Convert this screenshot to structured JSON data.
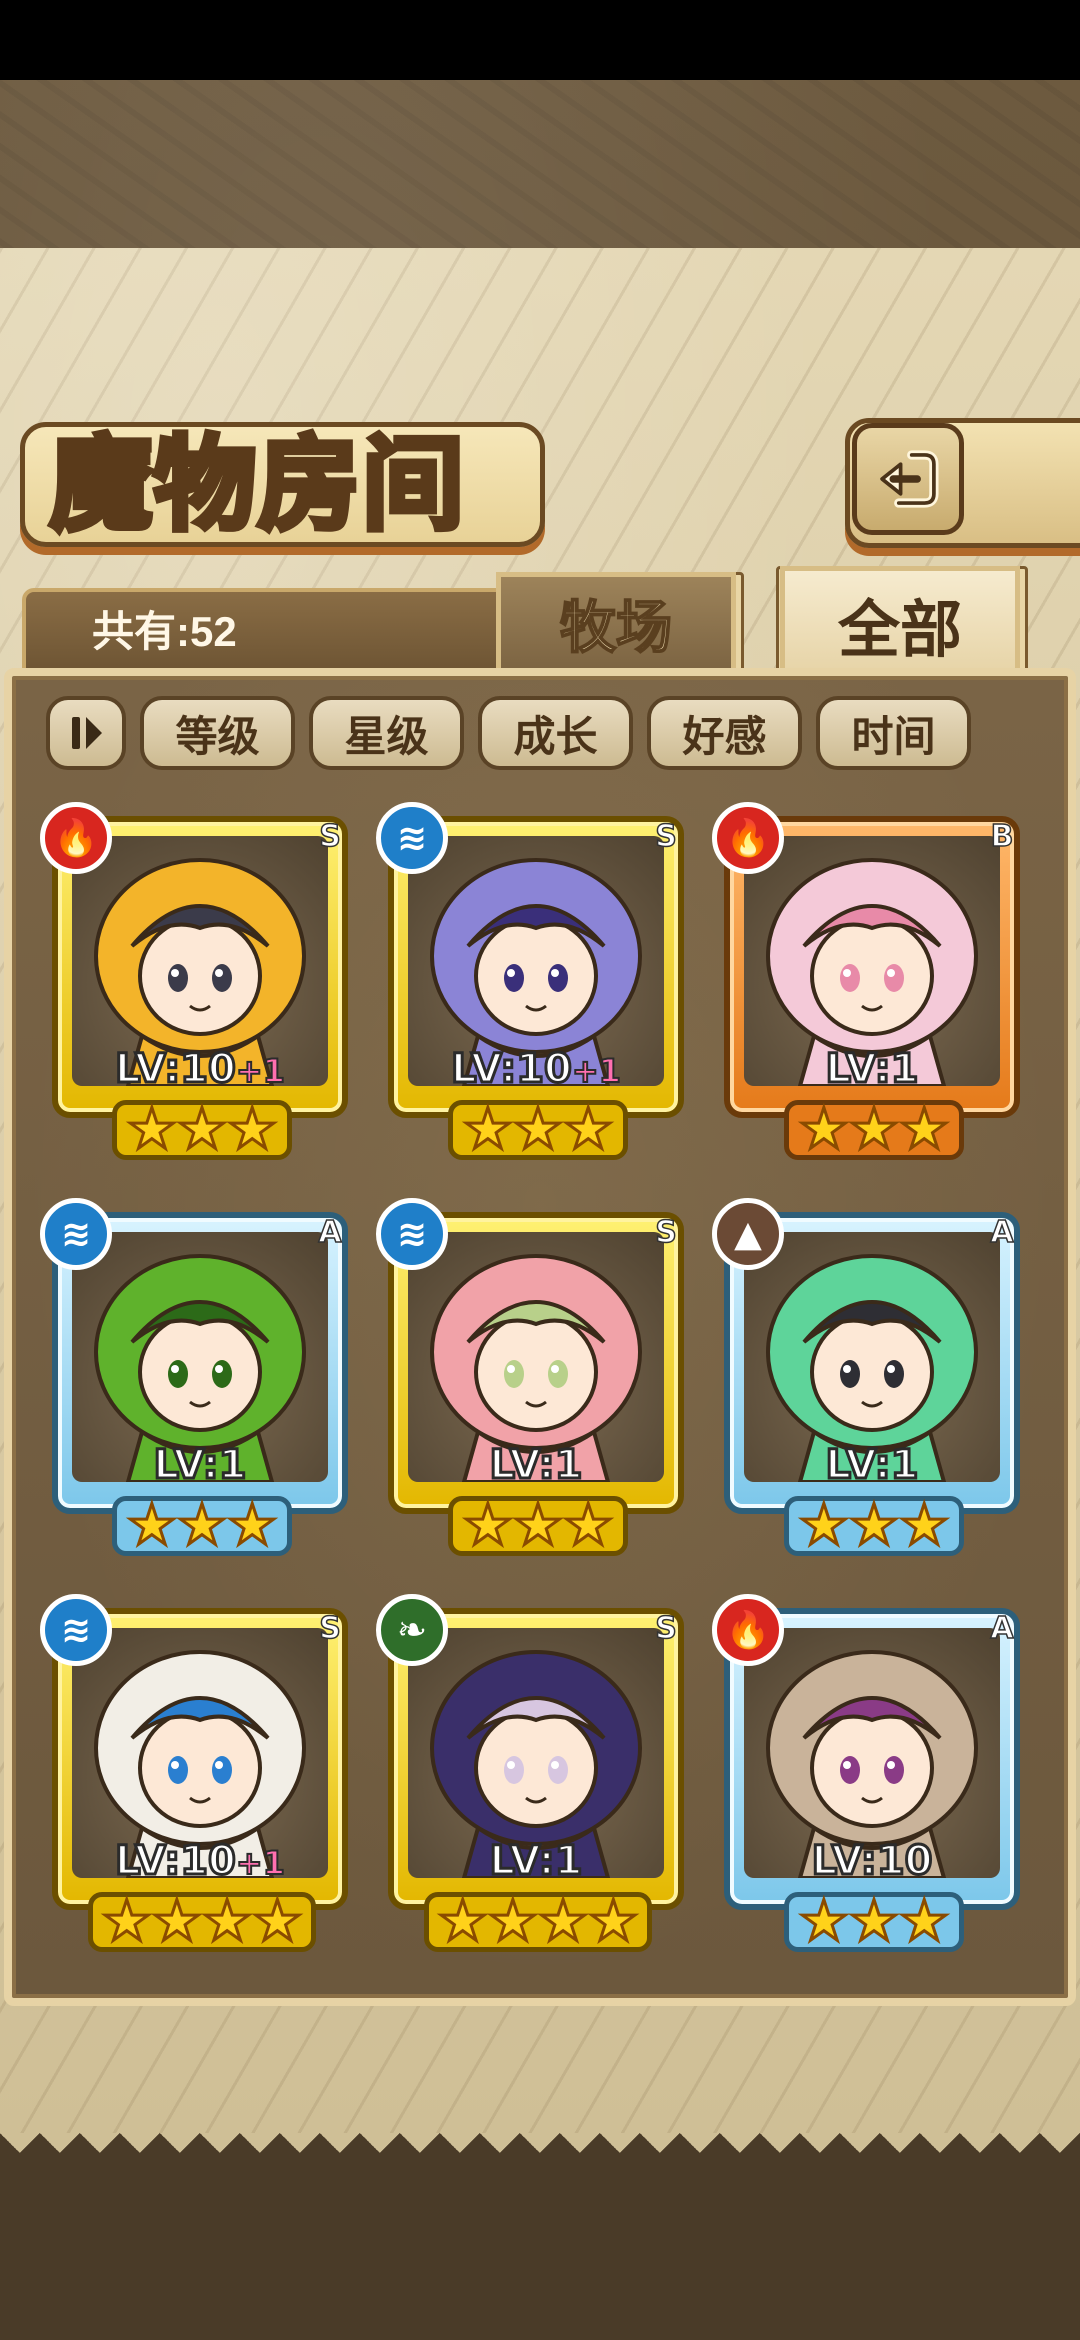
{
  "screen": {
    "title": "魔物房间",
    "count_label": "共有:52",
    "tabs": [
      {
        "label": "牧场",
        "selected": false
      },
      {
        "label": "全部",
        "selected": true
      }
    ],
    "back_icon": "back-arrow-icon"
  },
  "sort_buttons": [
    "等级",
    "星级",
    "成长",
    "好感",
    "时间"
  ],
  "sort_toggle_icon": "sort-order-icon",
  "colors": {
    "fire": "#d8261f",
    "water": "#1f7fc9",
    "earth": "#6b4a35",
    "wood": "#2f6e2a",
    "rank_S": "#e3b700",
    "rank_A": "#7cc7ea",
    "rank_B": "#e57a1a"
  },
  "monsters": [
    {
      "element": "fire",
      "element_icon": "fire-icon",
      "rank": "S",
      "level": "LV:10",
      "bonus": "+1",
      "stars": 3,
      "palette": [
        "#f3b42a",
        "#3b3b4a"
      ]
    },
    {
      "element": "water",
      "element_icon": "water-icon",
      "rank": "S",
      "level": "LV:10",
      "bonus": "+1",
      "stars": 3,
      "palette": [
        "#8b84d6",
        "#3a2f7a"
      ]
    },
    {
      "element": "fire",
      "element_icon": "fire-icon",
      "rank": "B",
      "level": "LV:1",
      "bonus": "",
      "stars": 3,
      "palette": [
        "#f4c9d8",
        "#e88aa8"
      ]
    },
    {
      "element": "water",
      "element_icon": "water-icon",
      "rank": "A",
      "level": "LV:1",
      "bonus": "",
      "stars": 3,
      "palette": [
        "#5fb22c",
        "#2c6a18"
      ]
    },
    {
      "element": "water",
      "element_icon": "water-icon",
      "rank": "S",
      "level": "LV:1",
      "bonus": "",
      "stars": 3,
      "palette": [
        "#f1a2a8",
        "#b8d08a"
      ]
    },
    {
      "element": "earth",
      "element_icon": "mountain-icon",
      "rank": "A",
      "level": "LV:1",
      "bonus": "",
      "stars": 3,
      "palette": [
        "#5ed49a",
        "#2e2e34"
      ]
    },
    {
      "element": "water",
      "element_icon": "water-icon",
      "rank": "S",
      "level": "LV:10",
      "bonus": "+1",
      "stars": 4,
      "palette": [
        "#f2eee6",
        "#2a7fd0"
      ]
    },
    {
      "element": "wood",
      "element_icon": "leaf-icon",
      "rank": "S",
      "level": "LV:1",
      "bonus": "",
      "stars": 4,
      "palette": [
        "#3a2f6a",
        "#d7c6e0"
      ]
    },
    {
      "element": "fire",
      "element_icon": "fire-icon",
      "rank": "A",
      "level": "LV:10",
      "bonus": "",
      "stars": 3,
      "palette": [
        "#c9b39a",
        "#8a3b86"
      ]
    }
  ]
}
